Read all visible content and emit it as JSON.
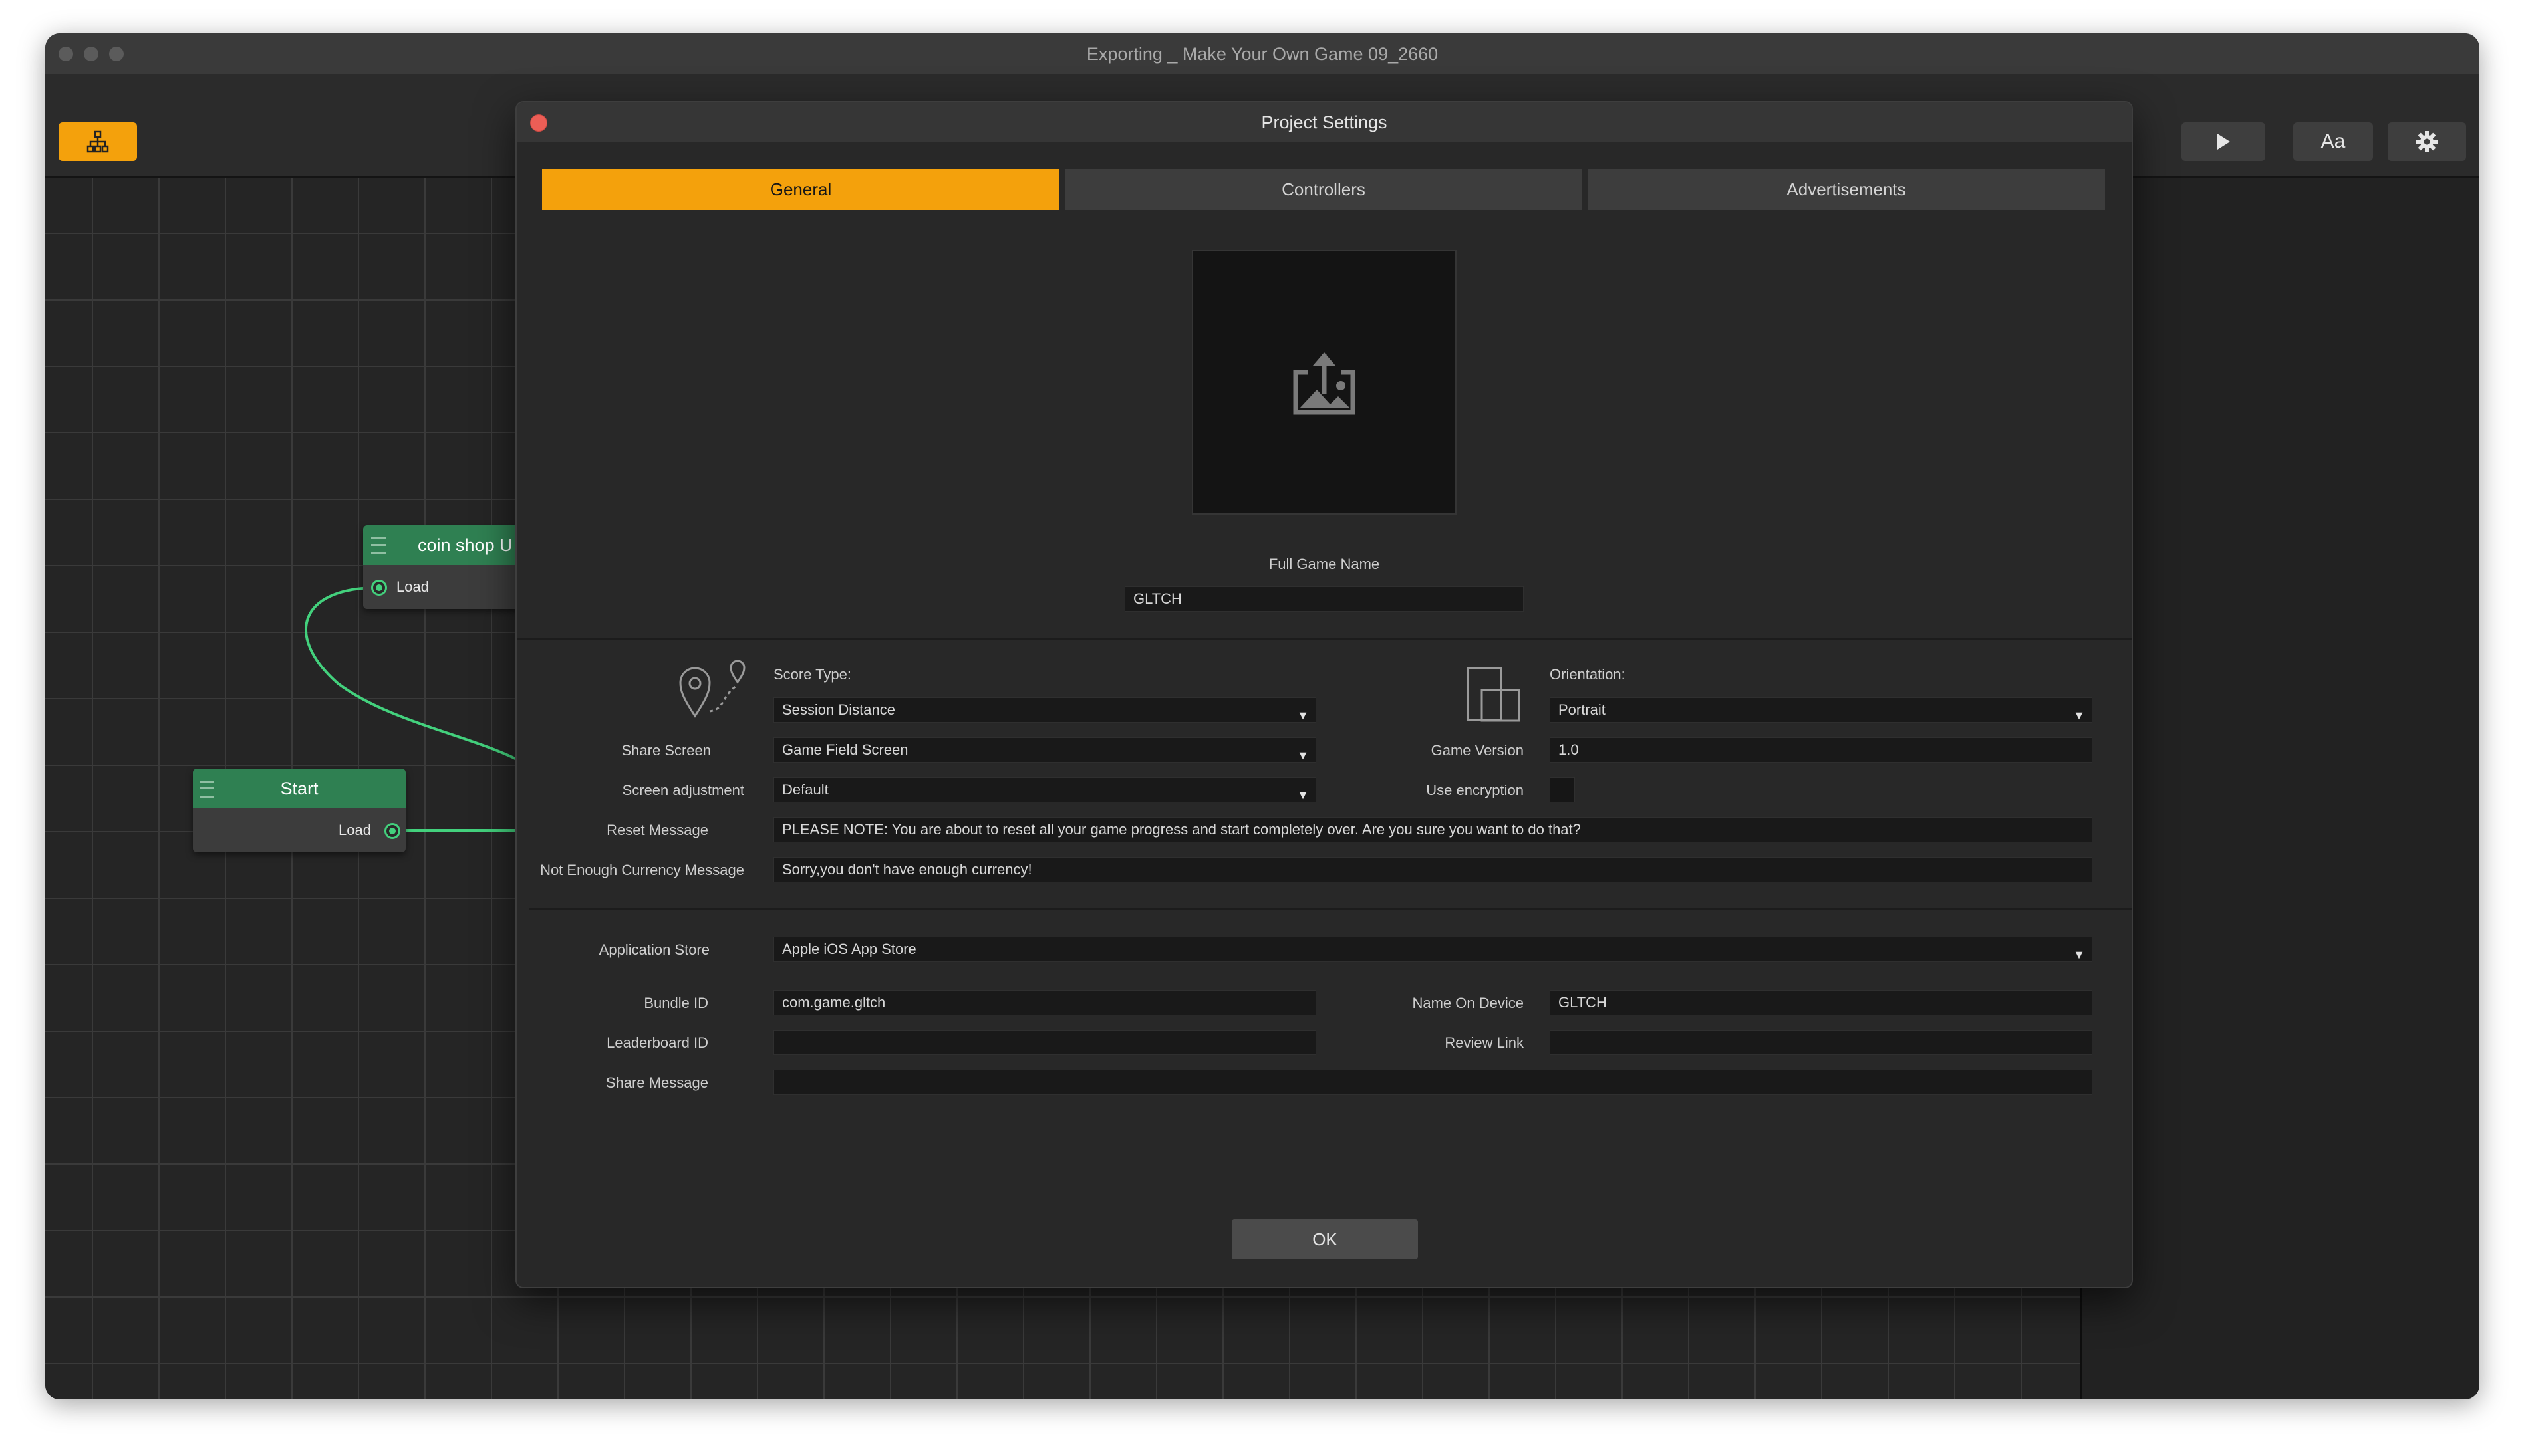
{
  "window": {
    "title": "Exporting _ Make Your Own Game 09_2660"
  },
  "toolbar": {
    "play_icon": "play-icon",
    "font_button_label": "Aa",
    "settings_icon": "gear-icon",
    "hierarchy_icon": "hierarchy-icon",
    "accent_color": "#f4a10c"
  },
  "canvas": {
    "nodes": [
      {
        "title": "coin shop U",
        "port_label": "Load"
      },
      {
        "title": "Start",
        "port_label": "Load"
      }
    ],
    "wire_color": "#43d17d",
    "node_color": "#2f8052"
  },
  "dialog": {
    "title": "Project Settings",
    "tabs": [
      {
        "label": "General",
        "active": true
      },
      {
        "label": "Controllers",
        "active": false
      },
      {
        "label": "Advertisements",
        "active": false
      }
    ],
    "image_icon": "image-upload-icon",
    "full_game_name": {
      "label": "Full Game Name",
      "value": "GLTCH"
    },
    "score_type": {
      "label": "Score Type:",
      "value": "Session Distance"
    },
    "share_screen": {
      "label": "Share Screen",
      "value": "Game Field Screen"
    },
    "screen_adjustment": {
      "label": "Screen adjustment",
      "value": "Default"
    },
    "orientation": {
      "label": "Orientation:",
      "value": "Portrait"
    },
    "game_version": {
      "label": "Game Version",
      "value": "1.0"
    },
    "use_encryption": {
      "label": "Use encryption",
      "checked": false
    },
    "reset_message": {
      "label": "Reset Message",
      "value": "PLEASE NOTE:  You are about to reset all your game progress and start completely over. Are you sure you want to do that?"
    },
    "not_enough_currency": {
      "label": "Not Enough Currency Message",
      "value": "Sorry,you don't have enough currency!"
    },
    "application_store": {
      "label": "Application Store",
      "value": "Apple iOS App Store"
    },
    "bundle_id": {
      "label": "Bundle ID",
      "value": "com.game.gltch"
    },
    "name_on_device": {
      "label": "Name On Device",
      "value": "GLTCH"
    },
    "leaderboard_id": {
      "label": "Leaderboard ID",
      "value": ""
    },
    "review_link": {
      "label": "Review Link",
      "value": ""
    },
    "share_message": {
      "label": "Share Message",
      "value": ""
    },
    "ok_label": "OK",
    "close_color": "#ec5e56"
  }
}
